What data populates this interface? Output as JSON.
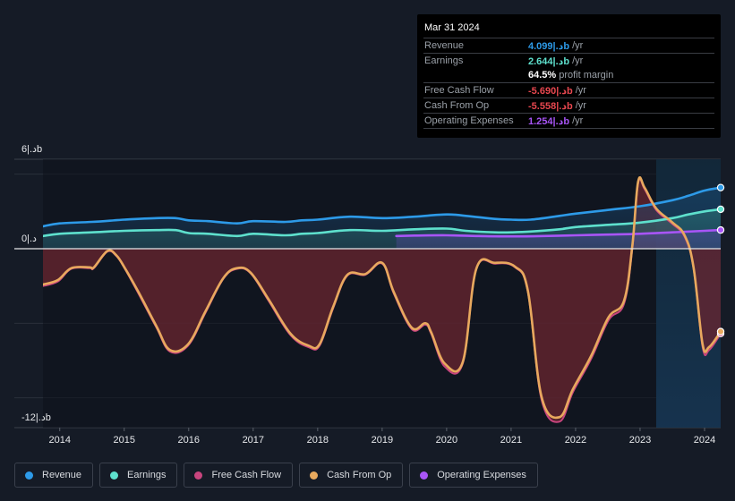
{
  "tooltip": {
    "date": "Mar 31 2024",
    "rows": [
      {
        "label": "Revenue",
        "value": "4.099|.دb",
        "unit": "/yr",
        "color": "#2d9ae8"
      },
      {
        "label": "Earnings",
        "value": "2.644|.دb",
        "unit": "/yr",
        "color": "#5ee0cd"
      },
      {
        "label": "",
        "value": "64.5%",
        "unit": "profit margin",
        "color": "#ffffff"
      },
      {
        "label": "Free Cash Flow",
        "value": "-5.690|.دb",
        "unit": "/yr",
        "color": "#e8474f"
      },
      {
        "label": "Cash From Op",
        "value": "-5.558|.دb",
        "unit": "/yr",
        "color": "#e8474f"
      },
      {
        "label": "Operating Expenses",
        "value": "1.254|.دb",
        "unit": "/yr",
        "color": "#a855f7"
      }
    ]
  },
  "legend": [
    {
      "label": "Revenue",
      "color": "#2d9ae8"
    },
    {
      "label": "Earnings",
      "color": "#5ee0cd"
    },
    {
      "label": "Free Cash Flow",
      "color": "#c8457e"
    },
    {
      "label": "Cash From Op",
      "color": "#e8a95e"
    },
    {
      "label": "Operating Expenses",
      "color": "#a855f7"
    }
  ],
  "chart_data": {
    "type": "line",
    "title": "",
    "xlabel": "",
    "ylabel": "",
    "unit_label": "|.دb",
    "ylim": [
      -12,
      6
    ],
    "y_tick_labels": [
      "6|.دb",
      "0|.د",
      "-12|.دb"
    ],
    "y_ticks": [
      6,
      0,
      -12
    ],
    "gridlines": [
      5,
      -5,
      -10
    ],
    "xlim": [
      2013.74,
      2024.25
    ],
    "x_tick_labels": [
      "2014",
      "2015",
      "2016",
      "2017",
      "2018",
      "2019",
      "2020",
      "2021",
      "2022",
      "2023",
      "2024"
    ],
    "x_ticks": [
      2014,
      2015,
      2016,
      2017,
      2018,
      2019,
      2020,
      2021,
      2022,
      2023,
      2024
    ],
    "highlight_from": 2023.25,
    "legend_position": "bottom",
    "series": [
      {
        "name": "Revenue",
        "color": "#2d9ae8",
        "x": [
          2013.74,
          2014.0,
          2014.5,
          2015.0,
          2015.5,
          2015.8,
          2016.0,
          2016.3,
          2016.75,
          2017.0,
          2017.5,
          2017.75,
          2018.0,
          2018.5,
          2019.0,
          2019.5,
          2020.0,
          2020.3,
          2020.75,
          2021.0,
          2021.3,
          2021.75,
          2022.0,
          2022.5,
          2023.0,
          2023.5,
          2023.75,
          2024.0,
          2024.25
        ],
        "y": [
          1.5,
          1.7,
          1.8,
          1.95,
          2.05,
          2.05,
          1.9,
          1.85,
          1.7,
          1.85,
          1.8,
          1.9,
          1.95,
          2.15,
          2.05,
          2.15,
          2.3,
          2.2,
          2.0,
          1.95,
          1.95,
          2.2,
          2.35,
          2.6,
          2.85,
          3.25,
          3.55,
          3.9,
          4.099
        ]
      },
      {
        "name": "Earnings",
        "color": "#5ee0cd",
        "x": [
          2013.74,
          2014.0,
          2014.5,
          2015.0,
          2015.5,
          2015.8,
          2016.0,
          2016.3,
          2016.75,
          2017.0,
          2017.5,
          2017.75,
          2018.0,
          2018.5,
          2019.0,
          2019.5,
          2020.0,
          2020.3,
          2020.75,
          2021.0,
          2021.3,
          2021.75,
          2022.0,
          2022.5,
          2023.0,
          2023.5,
          2023.75,
          2024.0,
          2024.25
        ],
        "y": [
          0.85,
          1.0,
          1.1,
          1.2,
          1.25,
          1.25,
          1.05,
          1.0,
          0.85,
          1.0,
          0.9,
          1.0,
          1.05,
          1.25,
          1.2,
          1.3,
          1.35,
          1.2,
          1.1,
          1.1,
          1.15,
          1.3,
          1.45,
          1.6,
          1.75,
          2.05,
          2.3,
          2.5,
          2.644
        ]
      },
      {
        "name": "Operating Expenses",
        "color": "#a855f7",
        "x": [
          2019.22,
          2019.5,
          2020.0,
          2020.5,
          2021.0,
          2021.5,
          2022.0,
          2022.5,
          2023.0,
          2023.5,
          2024.0,
          2024.25
        ],
        "y": [
          0.85,
          0.88,
          0.9,
          0.85,
          0.83,
          0.85,
          0.9,
          0.95,
          1.0,
          1.1,
          1.2,
          1.254
        ]
      },
      {
        "name": "Free Cash Flow",
        "color": "#c8457e",
        "x": [
          2013.74,
          2013.97,
          2014.18,
          2014.46,
          2014.53,
          2014.74,
          2014.88,
          2015.01,
          2015.22,
          2015.5,
          2015.71,
          2015.99,
          2016.26,
          2016.54,
          2016.75,
          2016.96,
          2017.24,
          2017.58,
          2017.86,
          2018.03,
          2018.24,
          2018.46,
          2018.74,
          2019.0,
          2019.18,
          2019.46,
          2019.67,
          2019.76,
          2019.97,
          2020.25,
          2020.46,
          2020.75,
          2021.06,
          2021.26,
          2021.47,
          2021.75,
          2021.96,
          2022.24,
          2022.51,
          2022.75,
          2022.88,
          2022.97,
          2023.07,
          2023.25,
          2023.49,
          2023.69,
          2023.83,
          2023.97,
          2024.07,
          2024.25
        ],
        "y": [
          -2.5,
          -2.2,
          -1.35,
          -1.3,
          -1.3,
          -0.2,
          -0.5,
          -1.35,
          -3.0,
          -5.3,
          -6.9,
          -6.5,
          -4.3,
          -2.0,
          -1.35,
          -1.65,
          -3.5,
          -5.8,
          -6.6,
          -6.5,
          -4.0,
          -1.8,
          -1.75,
          -1.0,
          -3.0,
          -5.4,
          -5.1,
          -5.7,
          -7.9,
          -7.7,
          -1.4,
          -1.0,
          -1.25,
          -2.9,
          -10.1,
          -11.6,
          -9.6,
          -7.4,
          -4.8,
          -3.7,
          0.0,
          4.4,
          4.0,
          2.6,
          1.7,
          0.8,
          -1.35,
          -6.6,
          -6.8,
          -5.69
        ]
      },
      {
        "name": "Cash From Op",
        "color": "#e8a95e",
        "x": [
          2013.74,
          2013.97,
          2014.18,
          2014.46,
          2014.53,
          2014.74,
          2014.88,
          2015.01,
          2015.22,
          2015.5,
          2015.71,
          2015.99,
          2016.26,
          2016.54,
          2016.75,
          2016.96,
          2017.24,
          2017.58,
          2017.86,
          2018.03,
          2018.24,
          2018.46,
          2018.74,
          2019.0,
          2019.18,
          2019.46,
          2019.67,
          2019.76,
          2019.97,
          2020.25,
          2020.46,
          2020.75,
          2021.06,
          2021.26,
          2021.47,
          2021.75,
          2021.96,
          2022.24,
          2022.51,
          2022.75,
          2022.88,
          2022.97,
          2023.07,
          2023.25,
          2023.49,
          2023.69,
          2023.83,
          2023.97,
          2024.07,
          2024.25
        ],
        "y": [
          -2.4,
          -2.1,
          -1.3,
          -1.25,
          -1.25,
          -0.15,
          -0.45,
          -1.3,
          -2.9,
          -5.2,
          -6.8,
          -6.4,
          -4.2,
          -1.95,
          -1.3,
          -1.6,
          -3.4,
          -5.7,
          -6.5,
          -6.4,
          -3.9,
          -1.75,
          -1.7,
          -0.95,
          -2.9,
          -5.3,
          -5.0,
          -5.6,
          -7.7,
          -7.6,
          -1.35,
          -0.95,
          -1.2,
          -2.8,
          -9.9,
          -11.3,
          -9.4,
          -7.2,
          -4.6,
          -3.5,
          0.2,
          4.5,
          4.1,
          2.7,
          1.8,
          0.9,
          -1.25,
          -6.4,
          -6.6,
          -5.558
        ]
      }
    ]
  }
}
